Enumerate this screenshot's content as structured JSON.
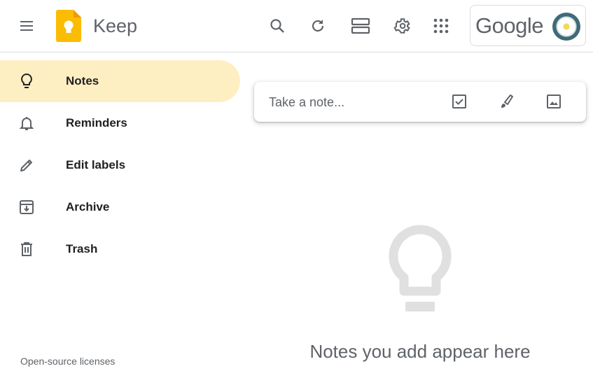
{
  "header": {
    "app_title": "Keep",
    "account_brand": "Google",
    "icons": [
      "menu-icon",
      "keep-logo-icon",
      "search-icon",
      "refresh-icon",
      "list-view-icon",
      "settings-icon",
      "apps-icon",
      "avatar"
    ]
  },
  "sidebar": {
    "items": [
      {
        "label": "Notes",
        "icon": "lightbulb-icon",
        "active": true
      },
      {
        "label": "Reminders",
        "icon": "bell-icon",
        "active": false
      },
      {
        "label": "Edit labels",
        "icon": "pencil-icon",
        "active": false
      },
      {
        "label": "Archive",
        "icon": "archive-icon",
        "active": false
      },
      {
        "label": "Trash",
        "icon": "trash-icon",
        "active": false
      }
    ],
    "footer_link": "Open-source licenses"
  },
  "note_input": {
    "placeholder": "Take a note...",
    "actions": [
      "new-list-icon",
      "new-drawing-icon",
      "new-image-icon"
    ]
  },
  "empty_state": {
    "message": "Notes you add appear here"
  },
  "colors": {
    "active_nav": "#feefc3",
    "logo_yellow": "#fbbc04",
    "icon_gray": "#5f6368",
    "empty_bulb": "#e0e0e0"
  }
}
